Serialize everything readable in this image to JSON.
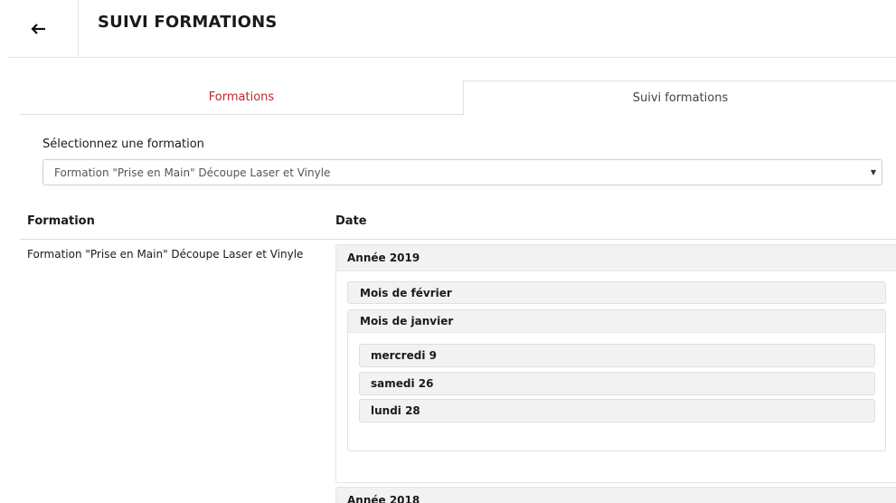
{
  "header": {
    "title": "SUIVI FORMATIONS",
    "back_icon": "arrow-left-icon"
  },
  "tabs": [
    {
      "label": "Formations",
      "active": false,
      "color": "#c0262c"
    },
    {
      "label": "Suivi formations",
      "active": true
    }
  ],
  "select": {
    "label": "Sélectionnez une formation",
    "value": "Formation \"Prise en Main\" Découpe Laser et Vinyle",
    "caret": "▼"
  },
  "table": {
    "columns": [
      "Formation",
      "Date"
    ],
    "row": {
      "formation": "Formation \"Prise en Main\" Découpe Laser et Vinyle",
      "years": [
        {
          "label": "Année 2019",
          "months": [
            {
              "label": "Mois de février",
              "expanded": false
            },
            {
              "label": "Mois de janvier",
              "expanded": true,
              "days": [
                "mercredi 9",
                "samedi 26",
                "lundi 28"
              ]
            }
          ]
        },
        {
          "label": "Année 2018"
        }
      ]
    }
  }
}
